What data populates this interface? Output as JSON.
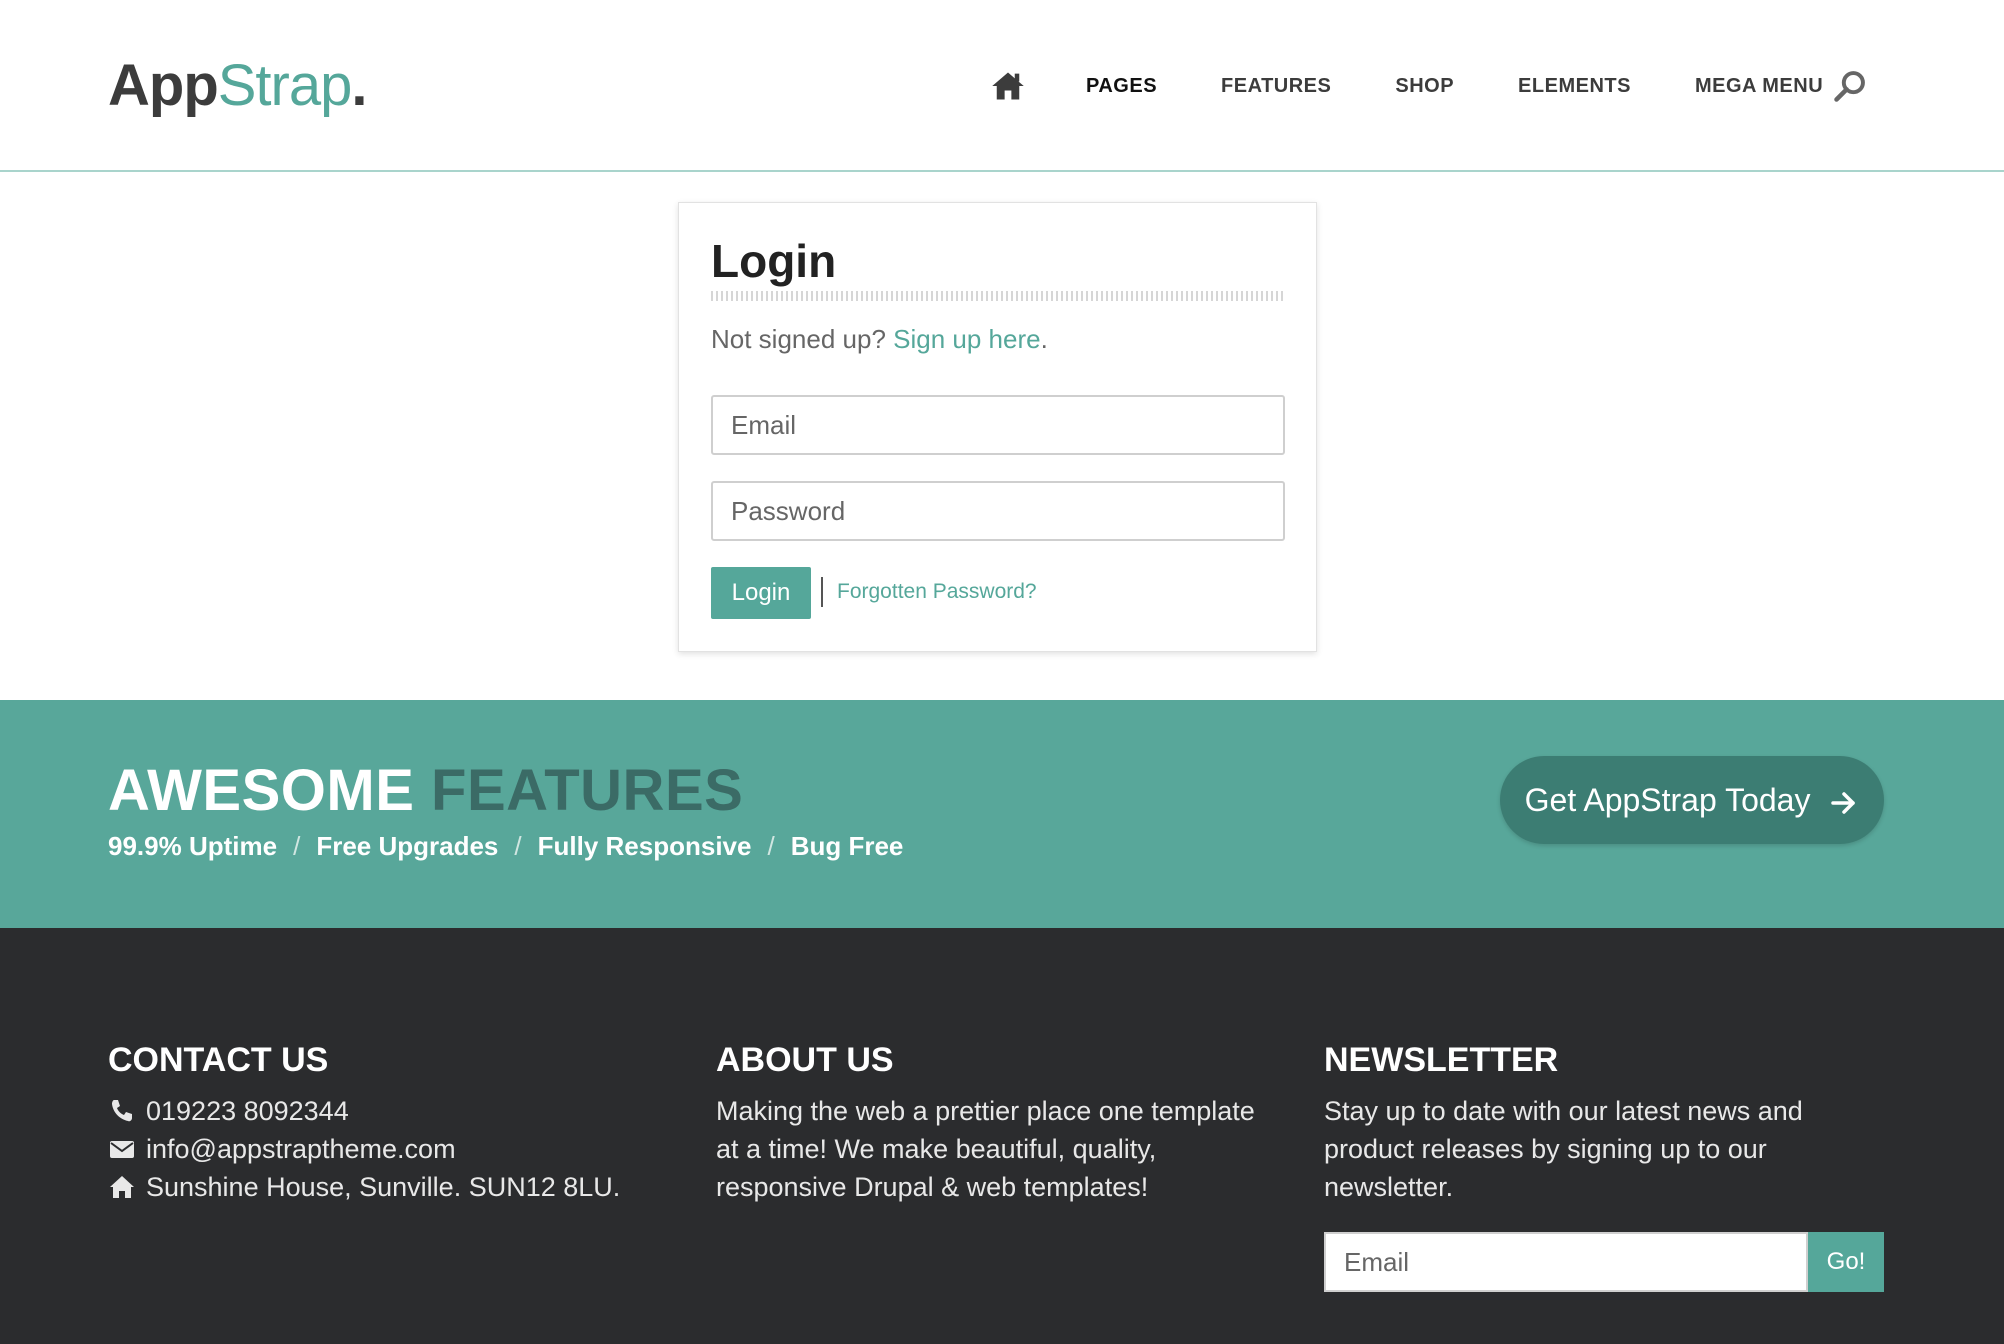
{
  "header": {
    "logo": {
      "part1": "App",
      "part2": "Strap",
      "part3": "."
    },
    "nav": [
      {
        "label": "PAGES",
        "active": true
      },
      {
        "label": "FEATURES",
        "active": false
      },
      {
        "label": "SHOP",
        "active": false
      },
      {
        "label": "ELEMENTS",
        "active": false
      },
      {
        "label": "MEGA MENU",
        "active": false
      }
    ],
    "home_icon": "home-icon",
    "search_icon": "search-icon"
  },
  "login": {
    "title": "Login",
    "prompt": "Not signed up? ",
    "signup_link": "Sign up here",
    "signup_period": ".",
    "email_placeholder": "Email",
    "password_placeholder": "Password",
    "button": "Login",
    "forgot_link": "Forgotten Password?"
  },
  "features": {
    "title_white": "AWESOME",
    "title_dark": "FEATURES",
    "perks": [
      "99.9% Uptime",
      "Free Upgrades",
      "Fully Responsive",
      "Bug Free"
    ],
    "separator": "/",
    "cta": "Get AppStrap Today",
    "cta_icon": "arrow-right-icon"
  },
  "footer": {
    "contact": {
      "title": "CONTACT US",
      "phone": "019223 8092344",
      "email": "info@appstraptheme.com",
      "address": "Sunshine House, Sunville. SUN12 8LU."
    },
    "about": {
      "title": "ABOUT US",
      "text": "Making the web a prettier place one template at a time! We make beautiful, quality, responsive Drupal & web templates!"
    },
    "newsletter": {
      "title": "NEWSLETTER",
      "text": "Stay up to date with our latest news and product releases by signing up to our newsletter.",
      "email_placeholder": "Email",
      "button": "Go!"
    }
  },
  "colors": {
    "accent": "#55a79a",
    "band": "#58a79a",
    "cta": "#3c7d73",
    "footer": "#2b2c2e"
  }
}
